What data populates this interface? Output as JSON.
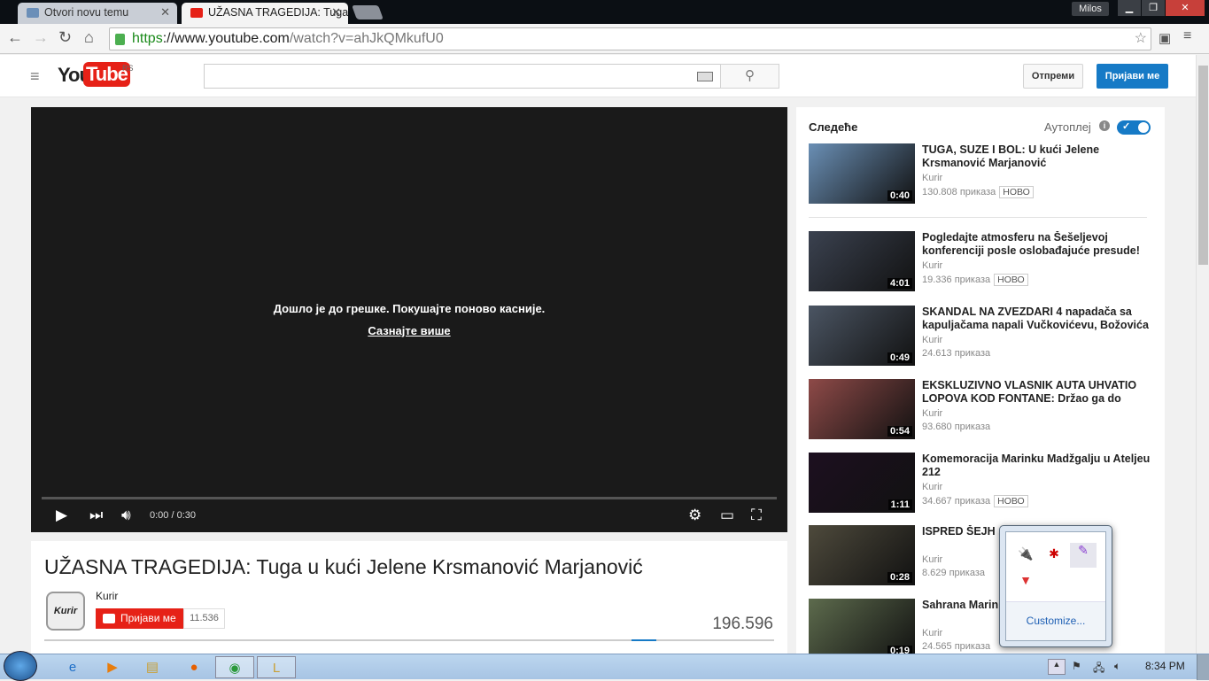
{
  "browser": {
    "tabs": [
      {
        "label": "Otvori novu temu",
        "active": false
      },
      {
        "label": "UŽASNA TRAGEDIJA: Tuga",
        "active": true
      }
    ],
    "user": "Milos",
    "url_scheme": "https",
    "url_host": "://www.youtube.com",
    "url_path": "/watch?v=ahJkQMkufU0"
  },
  "header": {
    "logo_you": "You",
    "logo_tube": "Tube",
    "region": "RS",
    "search_placeholder": "",
    "upload_label": "Отпреми",
    "signin_label": "Пријави ме"
  },
  "player": {
    "error_message": "Дошло је до грешке. Покушајте поново касније.",
    "learn_more": "Сазнајте више",
    "time": "0:00 / 0:30",
    "progress": 0
  },
  "video": {
    "title": "UŽASNA TRAGEDIJA: Tuga u kući Jelene Krsmanović Marjanović",
    "channel": "Kurir",
    "channel_logo": "Kurir",
    "subscribe_label": "Пријави ме",
    "subscriber_count": "11.536",
    "views": "196.596"
  },
  "sidebar": {
    "up_next": "Следеће",
    "autoplay_label": "Аутоплеј",
    "autoplay_on": true,
    "items": [
      {
        "title": "TUGA, SUZE I BOL: U kući Jelene Krsmanović Marjanović",
        "channel": "Kurir",
        "views": "130.808 приказа",
        "badge": "НОВО",
        "duration": "0:40",
        "color": "#6a8fb5"
      },
      {
        "title": "Pogledajte atmosferu na Šešeljevoj konferenciji posle oslobađajuće presude!",
        "channel": "Kurir",
        "views": "19.336 приказа",
        "badge": "НОВО",
        "duration": "4:01",
        "color": "#3b4250"
      },
      {
        "title": "SKANDAL NA ZVEZDARI 4 napadača sa kapuljačama napali Vučkovićevu, Božovića i",
        "channel": "Kurir",
        "views": "24.613 приказа",
        "badge": "",
        "duration": "0:49",
        "color": "#4b5563"
      },
      {
        "title": "EKSKLUZIVNO VLASNIK AUTA UHVATIO LOPOVA KOD FONTANE: Držao ga do",
        "channel": "Kurir",
        "views": "93.680 приказа",
        "badge": "",
        "duration": "0:54",
        "color": "#8e4a48"
      },
      {
        "title": "Komemoracija Marinku Madžgalju u Ateljeu 212",
        "channel": "Kurir",
        "views": "34.667 приказа",
        "badge": "НОВО",
        "duration": "1:11",
        "color": "#1d1020"
      },
      {
        "title": "ISPRED ŠEJH ... A: Sahranjen Ham",
        "channel": "Kurir",
        "views": "8.629 приказа",
        "badge": "",
        "duration": "0:28",
        "color": "#4e4a3c"
      },
      {
        "title": "Sahrana Marin",
        "channel": "Kurir",
        "views": "24.565 приказа",
        "badge": "",
        "duration": "0:19",
        "color": "#5d6b4d"
      }
    ]
  },
  "tray_popup": {
    "customize_label": "Customize..."
  },
  "taskbar": {
    "clock": "8:34 PM"
  }
}
